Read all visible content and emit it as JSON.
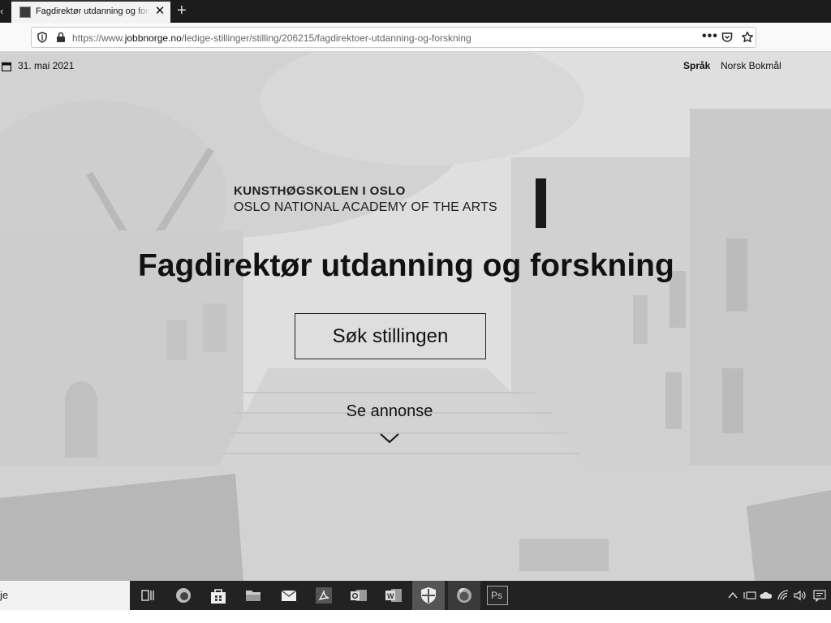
{
  "browser": {
    "tab_prev_glyph": "‹",
    "tab_title": "Fagdirektør utdanning og forsk",
    "tab_close_glyph": "✕",
    "new_tab_glyph": "+",
    "url_prefix": "https://www.",
    "url_host": "jobbnorge.no",
    "url_path": "/ledige-stillinger/stilling/206215/fagdirektoer-utdanning-og-forskning",
    "more_glyph": "•••"
  },
  "page": {
    "date": "31. mai 2021",
    "language_label": "Språk",
    "language_value": "Norsk Bokmål",
    "logo_line1": "KUNSTHØGSKOLEN I OSLO",
    "logo_line2": "OSLO NATIONAL ACADEMY OF THE ARTS",
    "job_title": "Fagdirektør utdanning og forskning",
    "apply_button": "Søk stillingen",
    "see_ad_link": "Se annonse"
  },
  "taskbar": {
    "search_text": "je",
    "icons": [
      "task-view-icon",
      "edge-icon",
      "store-icon",
      "file-explorer-icon",
      "mail-icon",
      "acrobat-icon",
      "outlook-icon",
      "word-icon",
      "security-icon",
      "firefox-icon",
      "photoshop-icon"
    ],
    "photoshop_label": "Ps",
    "tray_icons": [
      "chevron-up-icon",
      "network-adapter-icon",
      "onedrive-icon",
      "wifi-icon",
      "volume-icon",
      "notification-icon"
    ]
  },
  "colors": {
    "tabbar": "#1c1c1c",
    "taskbar": "#222222",
    "text": "#111111"
  }
}
